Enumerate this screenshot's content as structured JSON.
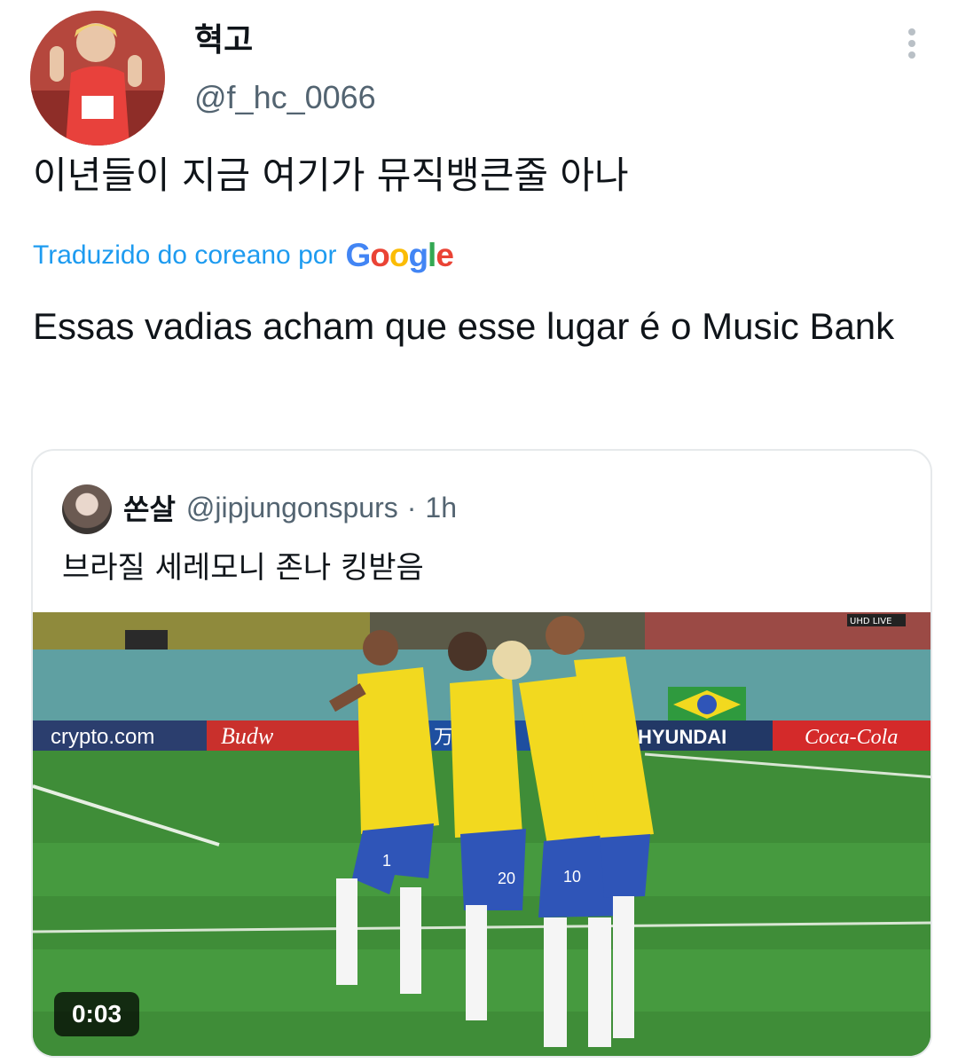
{
  "tweet": {
    "author_name": "혁고",
    "author_handle": "@f_hc_0066",
    "text": "이년들이 지금 여기가 뮤직뱅큰줄 아나",
    "translation_label": "Traduzido do coreano por",
    "translation_provider": [
      "G",
      "o",
      "o",
      "g",
      "l",
      "e"
    ],
    "translated_text": "Essas vadias acham que esse lugar é o Music Bank",
    "more_icon": "more-vertical-icon"
  },
  "quote": {
    "author_name": "쏜살",
    "author_handle": "@jipjungonspurs",
    "separator": "·",
    "time": "1h",
    "text": "브라질 세레모니 존나 킹받음",
    "media": {
      "duration": "0:03",
      "ads": [
        "crypto.com",
        "Budw",
        "万达",
        "HYUNDAI",
        "Coca-Cola"
      ],
      "live_tag": "UHD LIVE",
      "jersey_numbers": [
        "1",
        "20",
        "10"
      ]
    }
  },
  "colors": {
    "link_blue": "#1d9bf0",
    "secondary_text": "#536471",
    "border": "#e6e9eb",
    "pitch_green": "#3f8b3a",
    "brazil_yellow": "#f2d91f",
    "brazil_blue": "#2f55b8"
  }
}
